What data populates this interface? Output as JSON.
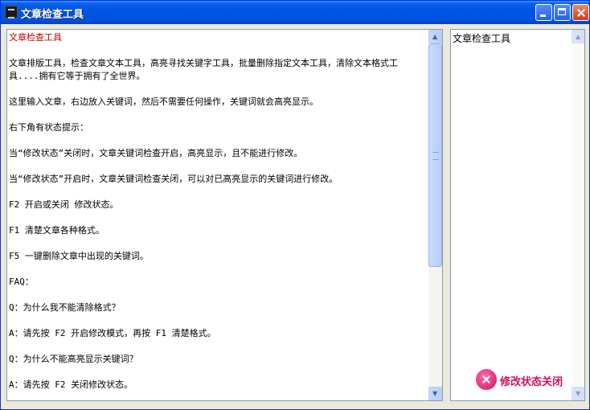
{
  "window": {
    "title": "文章检查工具"
  },
  "editor": {
    "lines": [
      "文章检查工具",
      "文章排版工具，检查文章文本工具，高亮寻找关键字工具，批量删除指定文本工具，清除文本格式工具....拥有它等于拥有了全世界。",
      "这里输入文章，右边放入关键词，然后不需要任何操作，关键词就会高亮显示。",
      "右下角有状态提示：",
      "当“修改状态”关闭时，文章关键词检查开启，高亮显示，且不能进行修改。",
      "当“修改状态”开启时，文章关键词检查关闭，可以对已高亮显示的关键词进行修改。",
      "F2 开启或关闭 修改状态。",
      "F1 清楚文章各种格式。",
      "F5 一键删除文章中出现的关键词。",
      "FAQ：",
      "Q：为什么我不能清除格式？",
      "A：请先按 F2 开启修改模式，再按 F1 清楚格式。",
      "Q：为什么不能高亮显示关键词？",
      "A：请先按 F2 关闭修改状态。"
    ]
  },
  "keywords": {
    "text": "文章检查工具"
  },
  "status": {
    "text": "修改状态关闭",
    "color": "#d0105a"
  },
  "icons": {
    "app": "app-icon",
    "status": "close-circle-icon"
  }
}
